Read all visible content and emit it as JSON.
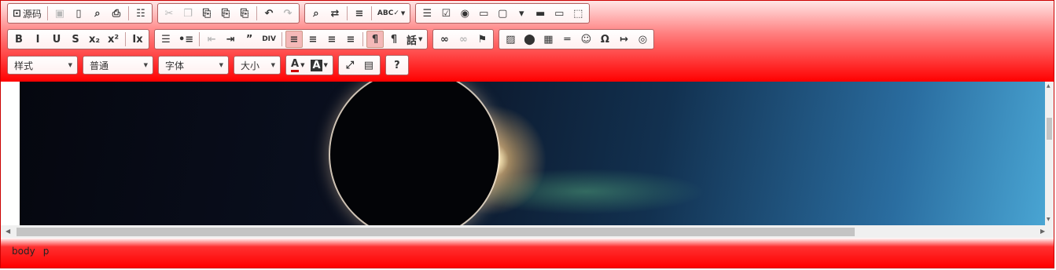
{
  "toolbar": {
    "source_label": "源码",
    "row1": [
      {
        "group": "document",
        "buttons": [
          {
            "name": "source-icon",
            "glyph": "⊡",
            "label": "源码",
            "disabled": false
          },
          {
            "sep": true
          },
          {
            "name": "save-icon",
            "glyph": "▣",
            "disabled": true
          },
          {
            "name": "new-page-icon",
            "glyph": "▯",
            "disabled": false
          },
          {
            "name": "preview-icon",
            "glyph": "⌕",
            "disabled": false
          },
          {
            "name": "print-icon",
            "glyph": "⎙",
            "disabled": false
          },
          {
            "sep": true
          },
          {
            "name": "templates-icon",
            "glyph": "☷",
            "disabled": false
          }
        ]
      },
      {
        "group": "clipboard",
        "buttons": [
          {
            "name": "cut-icon",
            "glyph": "✂",
            "disabled": true
          },
          {
            "name": "copy-icon",
            "glyph": "❐",
            "disabled": true
          },
          {
            "name": "paste-icon",
            "glyph": "⎘",
            "disabled": false
          },
          {
            "name": "paste-text-icon",
            "glyph": "⎘",
            "disabled": false
          },
          {
            "name": "paste-word-icon",
            "glyph": "⎘",
            "disabled": false
          },
          {
            "sep": true
          },
          {
            "name": "undo-icon",
            "glyph": "↶",
            "disabled": false
          },
          {
            "name": "redo-icon",
            "glyph": "↷",
            "disabled": true
          }
        ]
      },
      {
        "group": "editing",
        "buttons": [
          {
            "name": "find-icon",
            "glyph": "⌕",
            "disabled": false
          },
          {
            "name": "replace-icon",
            "glyph": "⇄",
            "disabled": false
          },
          {
            "sep": true
          },
          {
            "name": "select-all-icon",
            "glyph": "≡",
            "disabled": false
          },
          {
            "sep": true
          },
          {
            "name": "spellcheck-icon",
            "glyph": "ABC✓",
            "disabled": false,
            "dropdown": true
          }
        ]
      },
      {
        "group": "forms",
        "buttons": [
          {
            "name": "form-icon",
            "glyph": "☰",
            "disabled": false
          },
          {
            "name": "checkbox-icon",
            "glyph": "☑",
            "disabled": false
          },
          {
            "name": "radio-icon",
            "glyph": "◉",
            "disabled": false
          },
          {
            "name": "text-field-icon",
            "glyph": "▭",
            "disabled": false
          },
          {
            "name": "textarea-icon",
            "glyph": "▢",
            "disabled": false
          },
          {
            "name": "select-icon",
            "glyph": "▾",
            "disabled": false
          },
          {
            "name": "button-icon",
            "glyph": "▬",
            "disabled": false
          },
          {
            "name": "image-button-icon",
            "glyph": "▭",
            "disabled": false
          },
          {
            "name": "hidden-field-icon",
            "glyph": "⬚",
            "disabled": false
          }
        ]
      }
    ],
    "row2": [
      {
        "group": "basicstyles",
        "buttons": [
          {
            "name": "bold-icon",
            "glyph": "B",
            "disabled": false
          },
          {
            "name": "italic-icon",
            "glyph": "I",
            "disabled": false
          },
          {
            "name": "underline-icon",
            "glyph": "U",
            "disabled": false
          },
          {
            "name": "strike-icon",
            "glyph": "S",
            "disabled": false
          },
          {
            "name": "subscript-icon",
            "glyph": "x₂",
            "disabled": false
          },
          {
            "name": "superscript-icon",
            "glyph": "x²",
            "disabled": false
          },
          {
            "sep": true
          },
          {
            "name": "remove-format-icon",
            "glyph": "Ix",
            "disabled": false
          }
        ]
      },
      {
        "group": "paragraph",
        "buttons": [
          {
            "name": "numbered-list-icon",
            "glyph": "☰",
            "disabled": false
          },
          {
            "name": "bulleted-list-icon",
            "glyph": "•≡",
            "disabled": false
          },
          {
            "sep": true
          },
          {
            "name": "outdent-icon",
            "glyph": "⇤",
            "disabled": true
          },
          {
            "name": "indent-icon",
            "glyph": "⇥",
            "disabled": false
          },
          {
            "name": "blockquote-icon",
            "glyph": "”",
            "disabled": false
          },
          {
            "name": "create-div-icon",
            "glyph": "DIV",
            "disabled": false
          },
          {
            "sep": true
          },
          {
            "name": "align-left-icon",
            "glyph": "≡",
            "disabled": false,
            "active": true
          },
          {
            "name": "align-center-icon",
            "glyph": "≡",
            "disabled": false
          },
          {
            "name": "align-right-icon",
            "glyph": "≡",
            "disabled": false
          },
          {
            "name": "justify-icon",
            "glyph": "≡",
            "disabled": false
          },
          {
            "sep": true
          },
          {
            "name": "ltr-icon",
            "glyph": "¶",
            "disabled": false,
            "active": true
          },
          {
            "name": "rtl-icon",
            "glyph": "¶",
            "disabled": false
          },
          {
            "name": "language-icon",
            "glyph": "話",
            "disabled": false,
            "dropdown": true
          }
        ]
      },
      {
        "group": "links",
        "buttons": [
          {
            "name": "link-icon",
            "glyph": "∞",
            "disabled": false
          },
          {
            "name": "unlink-icon",
            "glyph": "∞",
            "disabled": true
          },
          {
            "name": "anchor-icon",
            "glyph": "⚑",
            "disabled": false
          }
        ]
      },
      {
        "group": "insert",
        "buttons": [
          {
            "name": "image-icon",
            "glyph": "▨",
            "disabled": false
          },
          {
            "name": "flash-icon",
            "glyph": "⬤",
            "disabled": false
          },
          {
            "name": "table-icon",
            "glyph": "▦",
            "disabled": false
          },
          {
            "name": "horizontal-rule-icon",
            "glyph": "═",
            "disabled": false
          },
          {
            "name": "smiley-icon",
            "glyph": "☺",
            "disabled": false
          },
          {
            "name": "special-char-icon",
            "glyph": "Ω",
            "disabled": false
          },
          {
            "name": "page-break-icon",
            "glyph": "↦",
            "disabled": false
          },
          {
            "name": "iframe-icon",
            "glyph": "◎",
            "disabled": false
          }
        ]
      }
    ],
    "row3": {
      "combos": [
        {
          "name": "styles-combo",
          "label": "样式",
          "width": 90
        },
        {
          "name": "format-combo",
          "label": "普通",
          "width": 90
        },
        {
          "name": "font-combo",
          "label": "字体",
          "width": 90
        },
        {
          "name": "font-size-combo",
          "label": "大小",
          "width": 60
        }
      ],
      "groups": [
        {
          "group": "colors",
          "buttons": [
            {
              "name": "text-color-icon",
              "glyph": "A",
              "disabled": false,
              "dropdown": true
            },
            {
              "name": "bg-color-icon",
              "glyph": "A",
              "disabled": false,
              "dropdown": true
            }
          ]
        },
        {
          "group": "tools",
          "buttons": [
            {
              "name": "maximize-icon",
              "glyph": "⤢",
              "disabled": false
            },
            {
              "name": "show-blocks-icon",
              "glyph": "▤",
              "disabled": false
            }
          ]
        },
        {
          "group": "about",
          "buttons": [
            {
              "name": "about-icon",
              "glyph": "?",
              "disabled": false
            }
          ]
        }
      ]
    }
  },
  "content": {
    "image_alt": "solar eclipse over starry sky"
  },
  "statusbar": {
    "path": [
      "body",
      "p"
    ]
  },
  "colors": {
    "toolbar_top": "#ffe6e6",
    "toolbar_bottom": "#ff0000",
    "border": "#cc0000"
  }
}
